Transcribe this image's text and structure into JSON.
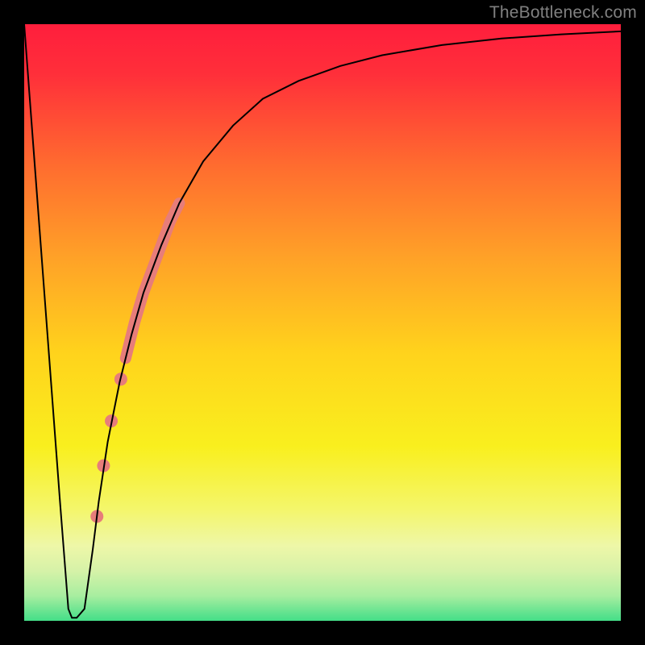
{
  "watermark": "TheBottleneck.com",
  "chart_data": {
    "type": "line",
    "title": "",
    "xlabel": "",
    "ylabel": "",
    "xlim": [
      0,
      100
    ],
    "ylim": [
      0,
      100
    ],
    "background_gradient_stops": [
      {
        "offset": 0.0,
        "color": "#ff1a3d"
      },
      {
        "offset": 0.1,
        "color": "#ff2f3a"
      },
      {
        "offset": 0.25,
        "color": "#ff6d2f"
      },
      {
        "offset": 0.4,
        "color": "#ffa327"
      },
      {
        "offset": 0.55,
        "color": "#ffd31c"
      },
      {
        "offset": 0.7,
        "color": "#f9ef1e"
      },
      {
        "offset": 0.8,
        "color": "#f4f66a"
      },
      {
        "offset": 0.86,
        "color": "#eef7a8"
      },
      {
        "offset": 0.9,
        "color": "#d6f2a8"
      },
      {
        "offset": 0.94,
        "color": "#a8eea0"
      },
      {
        "offset": 0.97,
        "color": "#5de28e"
      },
      {
        "offset": 1.0,
        "color": "#17d97e"
      }
    ],
    "series": [
      {
        "name": "bottleneck-curve",
        "color": "#000000",
        "stroke_width": 2,
        "x": [
          0.0,
          1.5,
          3.0,
          4.5,
          6.0,
          7.4,
          8.0,
          8.8,
          10.1,
          11.5,
          12.5,
          14.0,
          16.0,
          18.0,
          20.0,
          23.0,
          26.0,
          30.0,
          35.0,
          40.0,
          46.0,
          53.0,
          60.0,
          70.0,
          80.0,
          90.0,
          100.0
        ],
        "values": [
          100.0,
          80.0,
          60.0,
          40.0,
          20.0,
          2.0,
          0.5,
          0.5,
          2.0,
          12.0,
          20.0,
          30.0,
          40.0,
          48.0,
          55.0,
          63.0,
          70.0,
          77.0,
          83.0,
          87.5,
          90.5,
          93.0,
          94.8,
          96.5,
          97.6,
          98.3,
          98.8
        ]
      }
    ],
    "flat_bottom": {
      "x_start": 7.4,
      "x_end": 10.1,
      "y": 0.5
    },
    "highlight_segment": {
      "name": "salmon-curve-thick",
      "color": "#e77d7a",
      "stroke_width": 14,
      "x": [
        17.0,
        18.5,
        20.0,
        21.5,
        23.0,
        24.5,
        26.0
      ],
      "values": [
        44.0,
        50.0,
        55.0,
        59.0,
        63.0,
        67.0,
        70.0
      ]
    },
    "scatter_points": {
      "name": "salmon-dots",
      "color": "#e77d7a",
      "radius": 8,
      "points": [
        {
          "x": 16.2,
          "y": 40.5
        },
        {
          "x": 14.6,
          "y": 33.5
        },
        {
          "x": 13.3,
          "y": 26.0
        },
        {
          "x": 12.2,
          "y": 17.5
        }
      ]
    },
    "plot_border": {
      "color": "#000000",
      "width": 30
    }
  }
}
